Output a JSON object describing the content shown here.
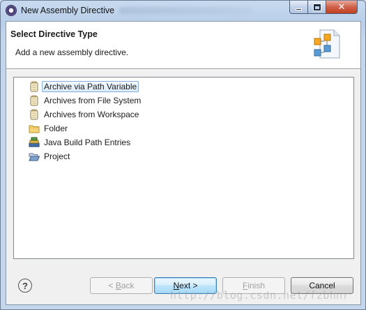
{
  "window": {
    "title": "New Assembly Directive",
    "controls": {
      "minimize": "minimize",
      "maximize": "maximize",
      "close": "✕"
    }
  },
  "banner": {
    "title": "Select Directive Type",
    "description": "Add a new assembly directive."
  },
  "tree": {
    "items": [
      {
        "label": "Archive via Path Variable",
        "icon": "jar-archive-icon",
        "selected": true
      },
      {
        "label": "Archives from File System",
        "icon": "jar-archive-icon",
        "selected": false
      },
      {
        "label": "Archives from Workspace",
        "icon": "jar-archive-icon",
        "selected": false
      },
      {
        "label": "Folder",
        "icon": "folder-icon",
        "selected": false
      },
      {
        "label": "Java Build Path Entries",
        "icon": "library-icon",
        "selected": false
      },
      {
        "label": "Project",
        "icon": "open-folder-icon",
        "selected": false
      }
    ]
  },
  "buttons": {
    "help": "?",
    "back": {
      "prefix": "< ",
      "mnemonic": "B",
      "rest": "ack",
      "enabled": false
    },
    "next": {
      "mnemonic": "N",
      "rest": "ext >",
      "enabled": true
    },
    "finish": {
      "mnemonic": "F",
      "rest": "inish",
      "enabled": false
    },
    "cancel": {
      "label": "Cancel",
      "enabled": true
    }
  },
  "watermark": "http://blog.csdn.net/fzbhnr",
  "colors": {
    "selection_fill": "#dcecfc",
    "selection_border": "#84acdd",
    "default_button": "#3c7fb1"
  }
}
